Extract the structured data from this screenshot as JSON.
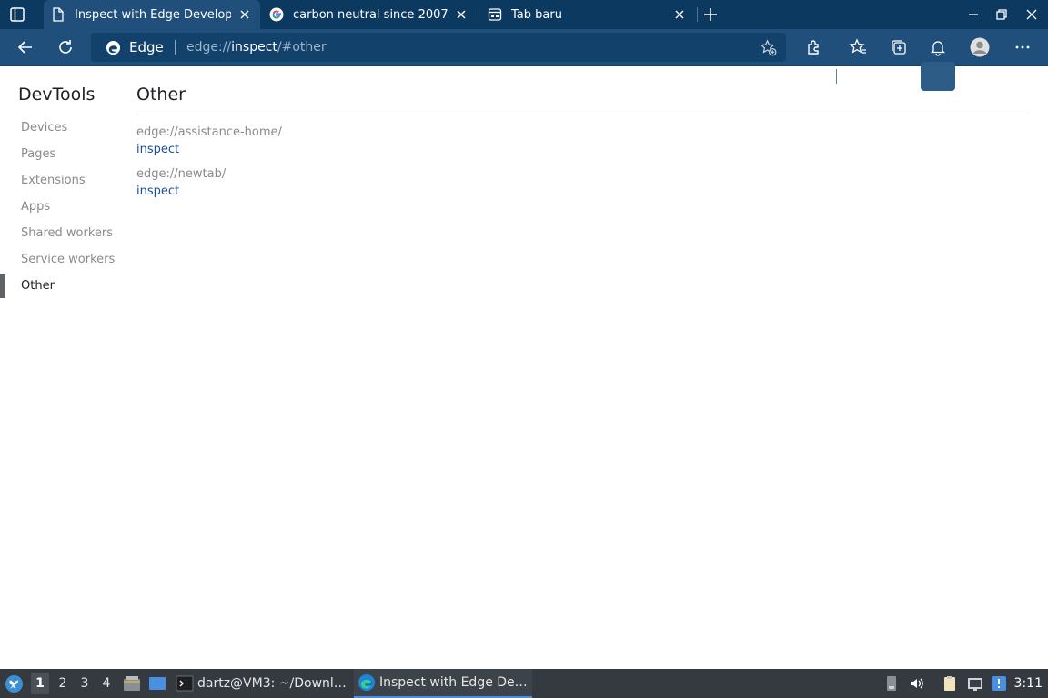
{
  "browser": {
    "tabs": [
      {
        "title": "Inspect with Edge Developer Tools",
        "icon": "page-icon",
        "active": true
      },
      {
        "title": "carbon neutral since 2007",
        "icon": "google-icon",
        "active": false
      },
      {
        "title": "Tab baru",
        "icon": "new-tab-page-icon",
        "active": false
      }
    ],
    "address": {
      "brand": "Edge",
      "scheme": "edge://",
      "host": "inspect",
      "path": "/#other"
    }
  },
  "page": {
    "sidebar_title": "DevTools",
    "nav": [
      {
        "label": "Devices",
        "selected": false
      },
      {
        "label": "Pages",
        "selected": false
      },
      {
        "label": "Extensions",
        "selected": false
      },
      {
        "label": "Apps",
        "selected": false
      },
      {
        "label": "Shared workers",
        "selected": false
      },
      {
        "label": "Service workers",
        "selected": false
      },
      {
        "label": "Other",
        "selected": true
      }
    ],
    "section_title": "Other",
    "targets": [
      {
        "url": "edge://assistance-home/",
        "action": "inspect"
      },
      {
        "url": "edge://newtab/",
        "action": "inspect"
      }
    ]
  },
  "taskbar": {
    "workspaces": [
      "1",
      "2",
      "3",
      "4"
    ],
    "current_workspace": "1",
    "tasks": [
      {
        "label": "dartz@VM3: ~/Downl…",
        "icon": "terminal-icon",
        "active": false
      },
      {
        "label": "Inspect with Edge De…",
        "icon": "edge-icon",
        "active": true
      }
    ],
    "clock": "3:11"
  },
  "colors": {
    "tabstrip": "#0c3960",
    "toolbar": "#1f4f7a",
    "link": "#1d4c9c",
    "taskbar": "#353a40"
  }
}
